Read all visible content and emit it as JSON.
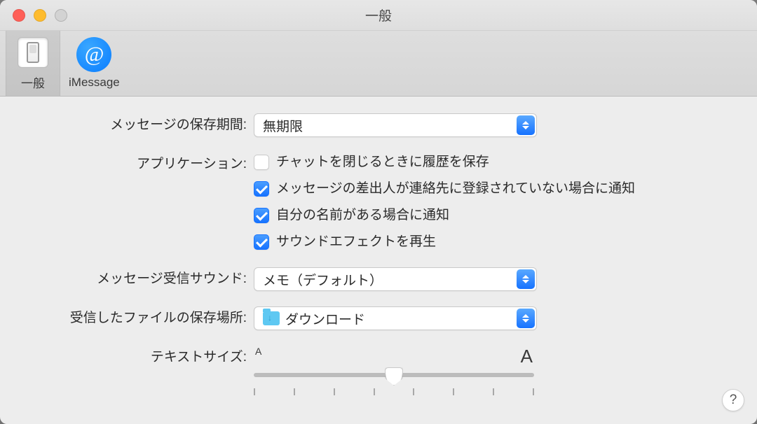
{
  "window": {
    "title": "一般"
  },
  "tabs": {
    "general": {
      "label": "一般"
    },
    "imessage": {
      "label": "iMessage"
    }
  },
  "rows": {
    "retention": {
      "label": "メッセージの保存期間:",
      "value": "無期限"
    },
    "application": {
      "label": "アプリケーション:",
      "opt_save_history": {
        "label": "チャットを閉じるときに履歴を保存",
        "checked": false
      },
      "opt_notify_unknown": {
        "label": "メッセージの差出人が連絡先に登録されていない場合に通知",
        "checked": true
      },
      "opt_notify_name": {
        "label": "自分の名前がある場合に通知",
        "checked": true
      },
      "opt_sound_effects": {
        "label": "サウンドエフェクトを再生",
        "checked": true
      }
    },
    "receive_sound": {
      "label": "メッセージ受信サウンド:",
      "value": "メモ（デフォルト）"
    },
    "download_location": {
      "label": "受信したファイルの保存場所:",
      "value": "ダウンロード"
    },
    "text_size": {
      "label": "テキストサイズ:",
      "small_marker": "A",
      "large_marker": "A"
    }
  },
  "help": {
    "label": "?"
  }
}
